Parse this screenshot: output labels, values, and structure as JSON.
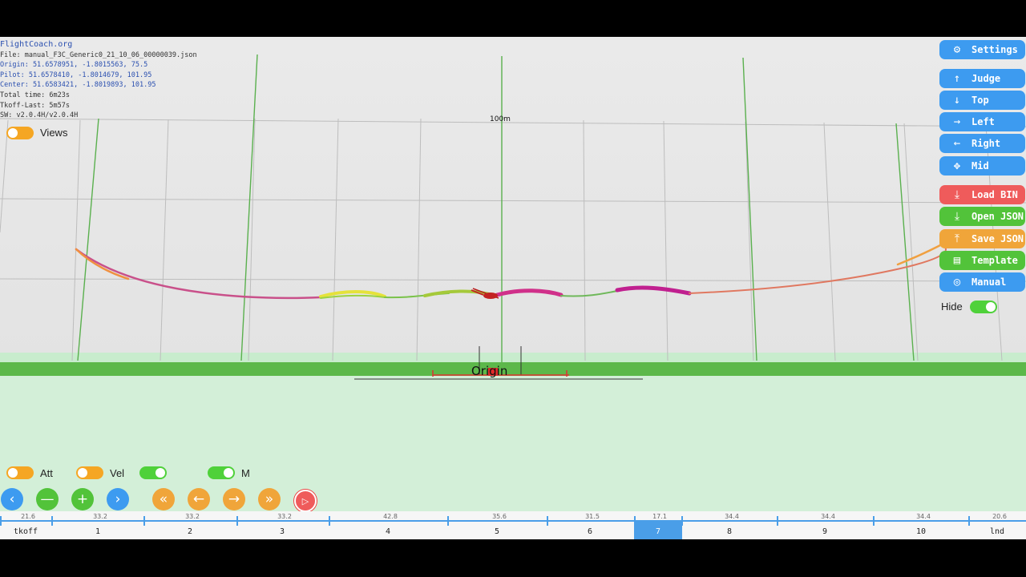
{
  "info": {
    "site": "FlightCoach.org",
    "file": "File: manual_F3C_Generic0_21_10_06_00000039.json",
    "origin": "Origin: 51.6578951, -1.8015563, 75.5",
    "pilot": "Pilot: 51.6578410, -1.8014679, 101.95",
    "center": "Center: 51.6583421, -1.8019893, 101.95",
    "total_time": "Total time: 6m23s",
    "tkoff_last": "Tkoff-Last: 5m57s",
    "sw": "SW: v2.0.4H/v2.0.4H"
  },
  "scene": {
    "distance_label": "100m",
    "origin_label": "Origin"
  },
  "toggles": {
    "views": {
      "label": "Views",
      "on": false
    },
    "att": {
      "label": "Att",
      "on": false
    },
    "vel": {
      "label": "Vel",
      "on": false
    },
    "third": {
      "label": "",
      "on": true
    },
    "m": {
      "label": "M",
      "on": true
    },
    "hide": {
      "label": "Hide",
      "on": true
    }
  },
  "right_panel": {
    "settings": {
      "label": "Settings",
      "icon": "gear-icon"
    },
    "judge": {
      "label": "Judge",
      "icon": "arrow-up-icon"
    },
    "top": {
      "label": "Top",
      "icon": "arrow-down-icon"
    },
    "left": {
      "label": "Left",
      "icon": "arrow-right-icon"
    },
    "right": {
      "label": "Right",
      "icon": "arrow-left-icon"
    },
    "mid": {
      "label": "Mid",
      "icon": "move-icon"
    },
    "load_bin": {
      "label": "Load BIN",
      "icon": "download-icon"
    },
    "open_json": {
      "label": "Open JSON",
      "icon": "download-icon"
    },
    "save_json": {
      "label": "Save JSON",
      "icon": "upload-icon"
    },
    "template": {
      "label": "Template",
      "icon": "document-icon"
    },
    "manual": {
      "label": "Manual",
      "icon": "lifebuoy-icon"
    }
  },
  "playback": {
    "icons": [
      "chevron-left-icon",
      "minus-icon",
      "plus-icon",
      "chevron-right-icon",
      "double-chevron-left-icon",
      "arrow-left-icon",
      "arrow-right-icon",
      "double-chevron-right-icon",
      "play-icon"
    ]
  },
  "timeline": {
    "durations": [
      "21.6",
      "33.2",
      "33.2",
      "33.2",
      "42.8",
      "35.6",
      "31.5",
      "17.1",
      "34.4",
      "34.4",
      "34.4",
      "20.6"
    ],
    "segments": [
      "tkoff",
      "1",
      "2",
      "3",
      "4",
      "5",
      "6",
      "7",
      "8",
      "9",
      "10",
      "lnd"
    ],
    "selected": "7"
  },
  "colors": {
    "accent_blue": "#3d9bf0",
    "red": "#ef5b5b",
    "green": "#52c33a",
    "orange": "#f0a53a"
  }
}
